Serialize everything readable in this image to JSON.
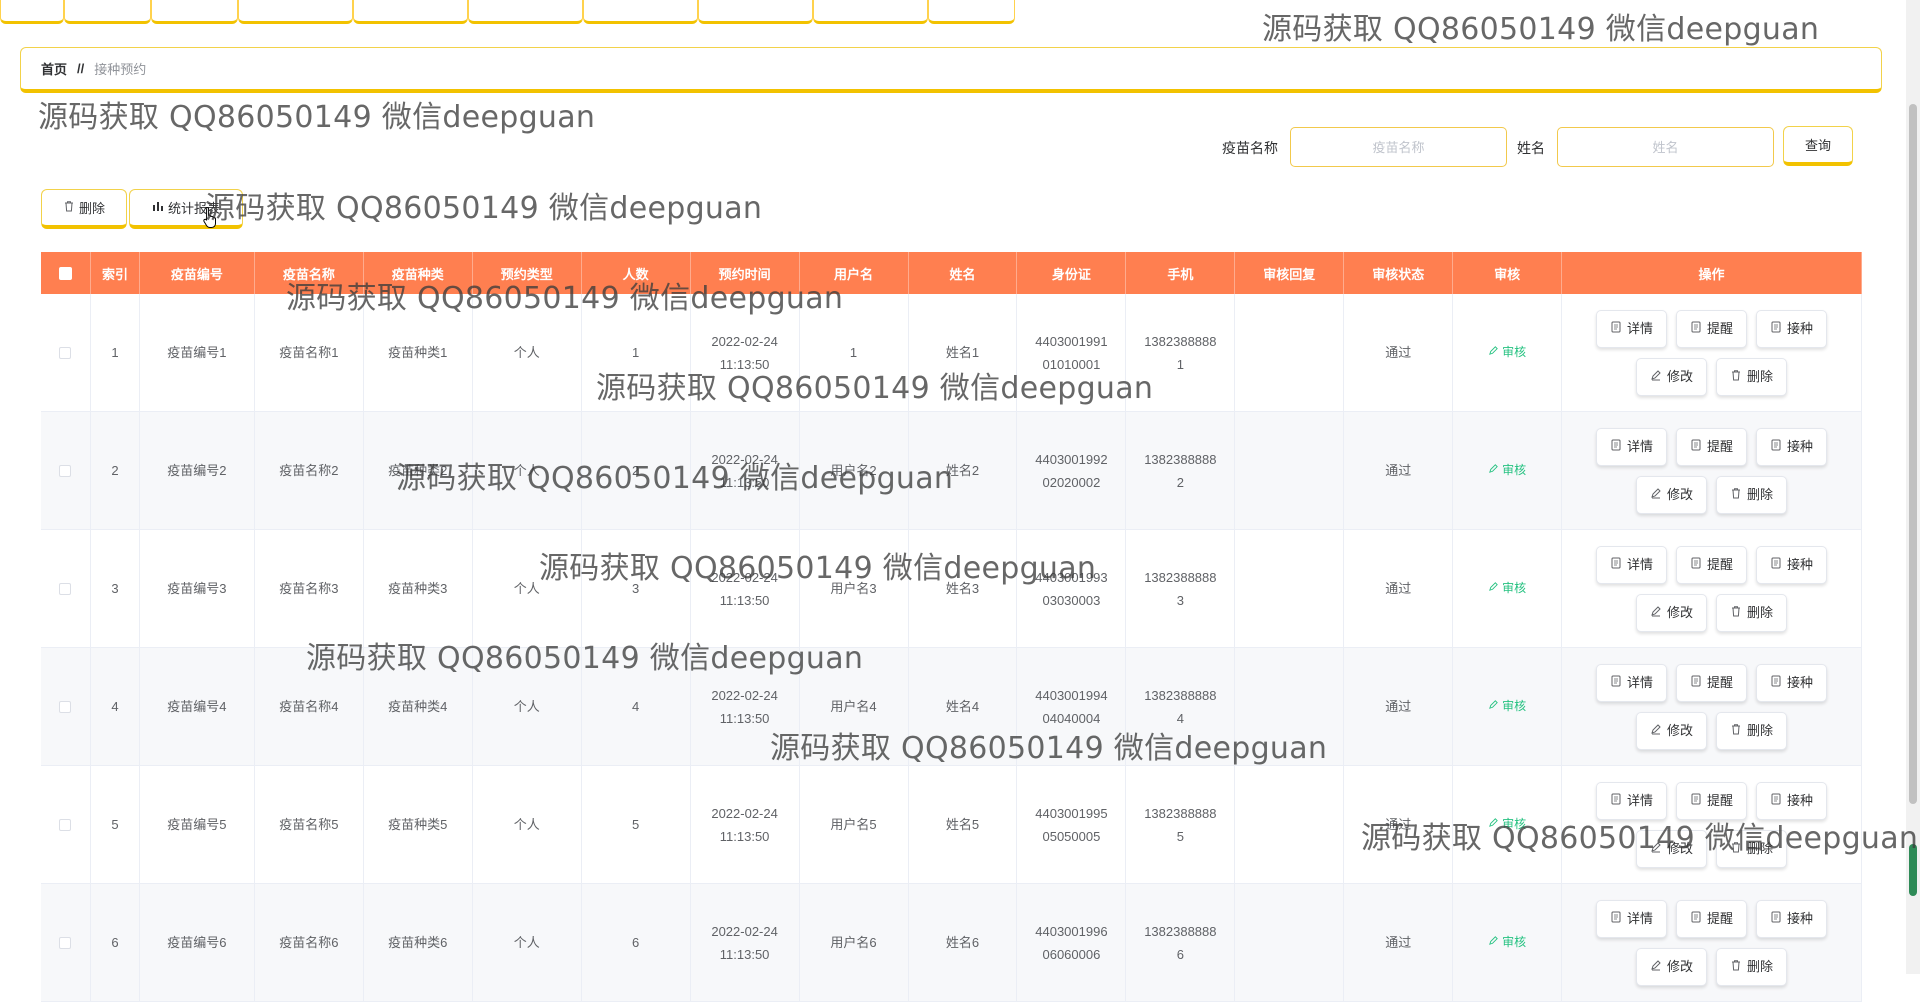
{
  "breadcrumb": {
    "home": "首页",
    "separator": "//",
    "current": "接种预约"
  },
  "search": {
    "vaccine_name_label": "疫苗名称",
    "vaccine_name_placeholder": "疫苗名称",
    "name_label": "姓名",
    "name_placeholder": "姓名",
    "query_button": "查询"
  },
  "toolbar": {
    "delete_label": "删除",
    "stats_label": "统计报表"
  },
  "table": {
    "columns": [
      "",
      "索引",
      "疫苗编号",
      "疫苗名称",
      "疫苗种类",
      "预约类型",
      "人数",
      "预约时间",
      "用户名",
      "姓名",
      "身份证",
      "手机",
      "审核回复",
      "审核状态",
      "审核",
      "操作"
    ],
    "audit_label": "审核",
    "action_labels": {
      "detail": "详情",
      "remind": "提醒",
      "vaccinate": "接种",
      "edit": "修改",
      "delete": "删除"
    },
    "rows": [
      {
        "index": "1",
        "code": "疫苗编号1",
        "vname": "疫苗名称1",
        "vtype": "疫苗种类1",
        "btype": "个人",
        "count": "1",
        "date": "2022-02-24",
        "time": "11:13:50",
        "username": "1",
        "name": "姓名1",
        "id1": "4403001991",
        "id2": "01010001",
        "phone1": "1382388888",
        "phone2": "1",
        "reply": "",
        "status": "通过"
      },
      {
        "index": "2",
        "code": "疫苗编号2",
        "vname": "疫苗名称2",
        "vtype": "疫苗种类2",
        "btype": "个人",
        "count": "2",
        "date": "2022-02-24",
        "time": "11:13:50",
        "username": "用户名2",
        "name": "姓名2",
        "id1": "4403001992",
        "id2": "02020002",
        "phone1": "1382388888",
        "phone2": "2",
        "reply": "",
        "status": "通过"
      },
      {
        "index": "3",
        "code": "疫苗编号3",
        "vname": "疫苗名称3",
        "vtype": "疫苗种类3",
        "btype": "个人",
        "count": "3",
        "date": "2022-02-24",
        "time": "11:13:50",
        "username": "用户名3",
        "name": "姓名3",
        "id1": "4403001993",
        "id2": "03030003",
        "phone1": "1382388888",
        "phone2": "3",
        "reply": "",
        "status": "通过"
      },
      {
        "index": "4",
        "code": "疫苗编号4",
        "vname": "疫苗名称4",
        "vtype": "疫苗种类4",
        "btype": "个人",
        "count": "4",
        "date": "2022-02-24",
        "time": "11:13:50",
        "username": "用户名4",
        "name": "姓名4",
        "id1": "4403001994",
        "id2": "04040004",
        "phone1": "1382388888",
        "phone2": "4",
        "reply": "",
        "status": "通过"
      },
      {
        "index": "5",
        "code": "疫苗编号5",
        "vname": "疫苗名称5",
        "vtype": "疫苗种类5",
        "btype": "个人",
        "count": "5",
        "date": "2022-02-24",
        "time": "11:13:50",
        "username": "用户名5",
        "name": "姓名5",
        "id1": "4403001995",
        "id2": "05050005",
        "phone1": "1382388888",
        "phone2": "5",
        "reply": "",
        "status": "通过"
      },
      {
        "index": "6",
        "code": "疫苗编号6",
        "vname": "疫苗名称6",
        "vtype": "疫苗种类6",
        "btype": "个人",
        "count": "6",
        "date": "2022-02-24",
        "time": "11:13:50",
        "username": "用户名6",
        "name": "姓名6",
        "id1": "4403001996",
        "id2": "06060006",
        "phone1": "1382388888",
        "phone2": "6",
        "reply": "",
        "status": "通过"
      }
    ]
  },
  "watermark": "源码获取 QQ86050149 微信deepguan",
  "colors": {
    "header_bg": "#ff7f50",
    "accent_yellow": "#f2c200",
    "audit_green": "#26c281"
  }
}
